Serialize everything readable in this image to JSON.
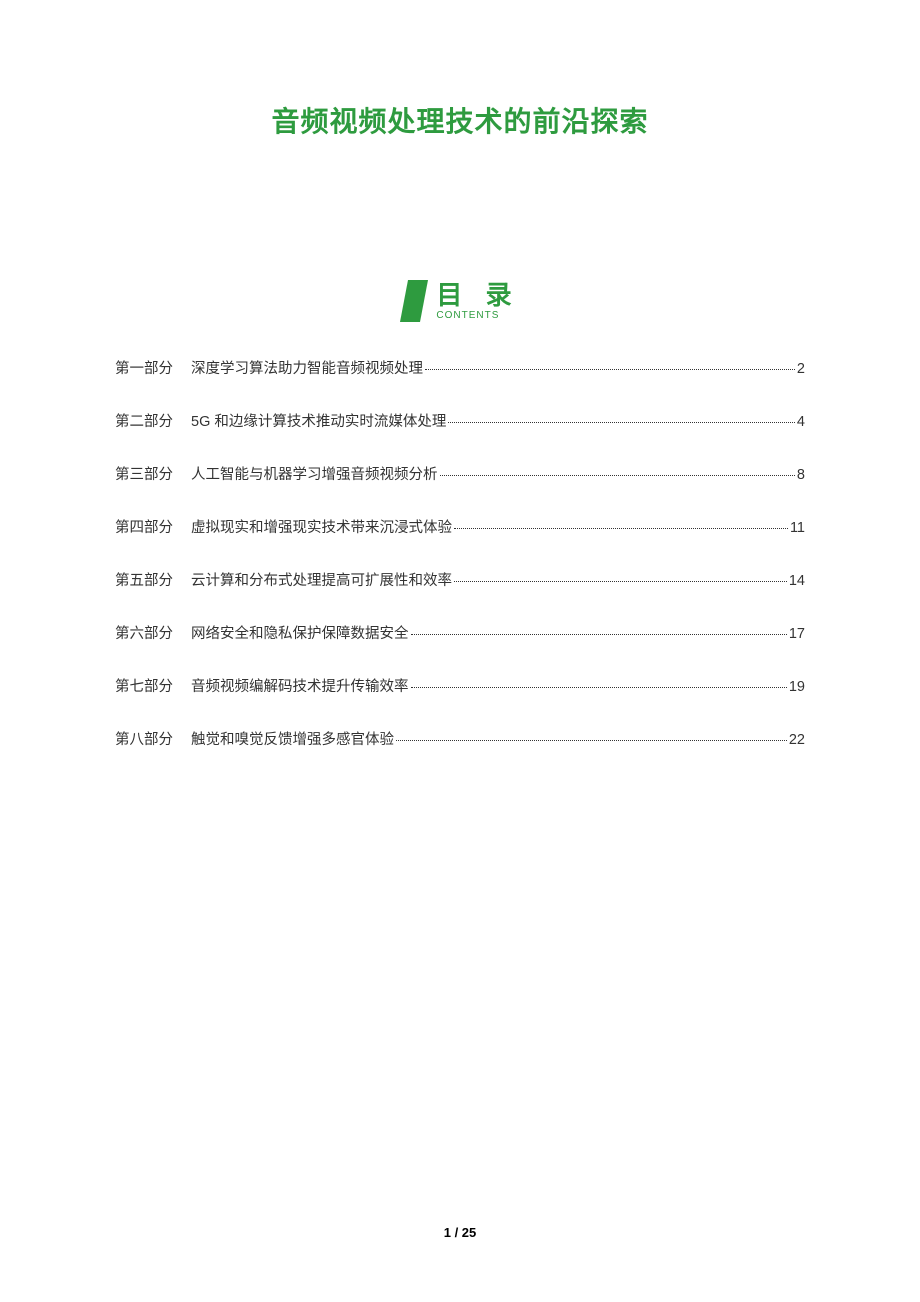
{
  "title": "音频视频处理技术的前沿探索",
  "toc": {
    "heading": "目 录",
    "subheading": "CONTENTS",
    "items": [
      {
        "part": "第一部分",
        "chapter": "深度学习算法助力智能音频视频处理",
        "page": "2"
      },
      {
        "part": "第二部分",
        "chapter": "5G 和边缘计算技术推动实时流媒体处理",
        "page": "4"
      },
      {
        "part": "第三部分",
        "chapter": "人工智能与机器学习增强音频视频分析",
        "page": "8"
      },
      {
        "part": "第四部分",
        "chapter": "虚拟现实和增强现实技术带来沉浸式体验",
        "page": "11"
      },
      {
        "part": "第五部分",
        "chapter": "云计算和分布式处理提高可扩展性和效率",
        "page": "14"
      },
      {
        "part": "第六部分",
        "chapter": "网络安全和隐私保护保障数据安全",
        "page": "17"
      },
      {
        "part": "第七部分",
        "chapter": "音频视频编解码技术提升传输效率",
        "page": "19"
      },
      {
        "part": "第八部分",
        "chapter": "触觉和嗅觉反馈增强多感官体验",
        "page": "22"
      }
    ]
  },
  "footer": {
    "current_page": "1",
    "separator": " / ",
    "total_pages": "25"
  },
  "colors": {
    "accent": "#2e9b3f"
  }
}
